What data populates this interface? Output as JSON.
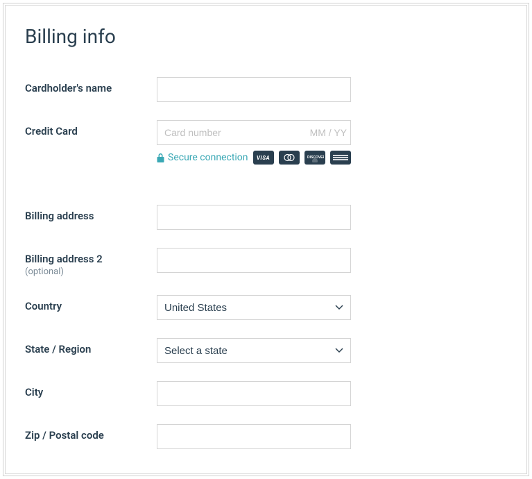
{
  "title": "Billing info",
  "fields": {
    "cardholder": {
      "label": "Cardholder's name",
      "value": ""
    },
    "creditCard": {
      "label": "Credit Card",
      "numberPlaceholder": "Card number",
      "expPlaceholder": "MM / YY",
      "secureText": "Secure connection",
      "cardBrands": [
        "visa",
        "mastercard",
        "discover",
        "amex"
      ]
    },
    "billingAddress": {
      "label": "Billing address",
      "value": ""
    },
    "billingAddress2": {
      "label": "Billing address 2",
      "optionalText": "(optional)",
      "value": ""
    },
    "country": {
      "label": "Country",
      "selected": "United States",
      "options": [
        "United States"
      ]
    },
    "state": {
      "label": "State / Region",
      "selected": "Select a state",
      "options": [
        "Select a state"
      ]
    },
    "city": {
      "label": "City",
      "value": ""
    },
    "zip": {
      "label": "Zip / Postal code",
      "value": ""
    }
  }
}
